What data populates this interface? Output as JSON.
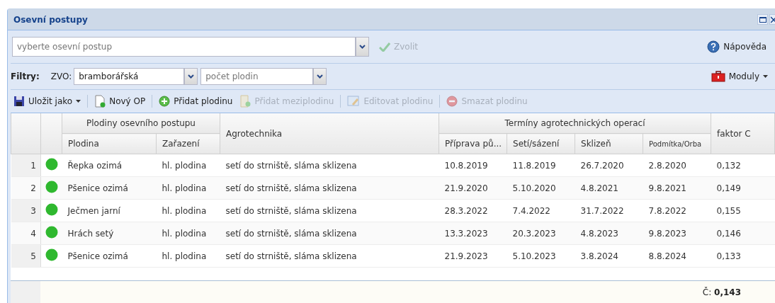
{
  "window": {
    "title": "Osevní postupy"
  },
  "selector": {
    "placeholder": "vyberte osevní postup",
    "confirm": {
      "label": "Zvolit",
      "disabled": true
    },
    "help": "Nápověda"
  },
  "filters": {
    "label": "Filtry:",
    "zvo_label": "ZVO:",
    "zvo_value": "bramborářská",
    "count_placeholder": "počet plodin",
    "modules": "Moduly"
  },
  "toolbar": [
    {
      "label": "Uložit jako",
      "dropdown": true,
      "disabled": false
    },
    {
      "label": "Nový OP",
      "dropdown": false,
      "disabled": false
    },
    {
      "label": "Přidat plodinu",
      "dropdown": false,
      "disabled": false
    },
    {
      "label": "Přidat meziplodinu",
      "dropdown": false,
      "disabled": true
    },
    {
      "label": "Editovat plodinu",
      "dropdown": false,
      "disabled": true
    },
    {
      "label": "Smazat plodinu",
      "dropdown": false,
      "disabled": true
    }
  ],
  "table": {
    "group_crops": "Plodiny osevního postupu",
    "group_dates": "Termíny agrotechnických operací",
    "columns": [
      "Plodina",
      "Zařazení",
      "Agrotechnika",
      "Příprava pů...",
      "Setí/sázení",
      "Sklizeň",
      "Podmítka/Orba",
      "faktor C"
    ],
    "rows": [
      {
        "num": "1",
        "cells": [
          "Řepka ozimá",
          "hl. plodina",
          "setí do strniště, sláma sklizena",
          "10.8.2019",
          "11.8.2019",
          "26.7.2020",
          "2.8.2020",
          "0,132"
        ]
      },
      {
        "num": "2",
        "cells": [
          "Pšenice ozimá",
          "hl. plodina",
          "setí do strniště, sláma sklizena",
          "21.9.2020",
          "5.10.2020",
          "4.8.2021",
          "9.8.2021",
          "0,149"
        ]
      },
      {
        "num": "3",
        "cells": [
          "Ječmen jarní",
          "hl. plodina",
          "setí do strniště, sláma sklizena",
          "28.3.2022",
          "7.4.2022",
          "31.7.2022",
          "7.8.2022",
          "0,155"
        ]
      },
      {
        "num": "4",
        "cells": [
          "Hrách setý",
          "hl. plodina",
          "setí do strniště, sláma sklizena",
          "13.3.2023",
          "20.3.2023",
          "4.8.2023",
          "9.8.2023",
          "0,146"
        ]
      },
      {
        "num": "5",
        "cells": [
          "Pšenice ozimá",
          "hl. plodina",
          "setí do strniště, sláma sklizena",
          "21.9.2023",
          "5.10.2023",
          "3.8.2024",
          "8.8.2024",
          "0,133"
        ]
      }
    ],
    "summary": "Č: **0,143**"
  }
}
